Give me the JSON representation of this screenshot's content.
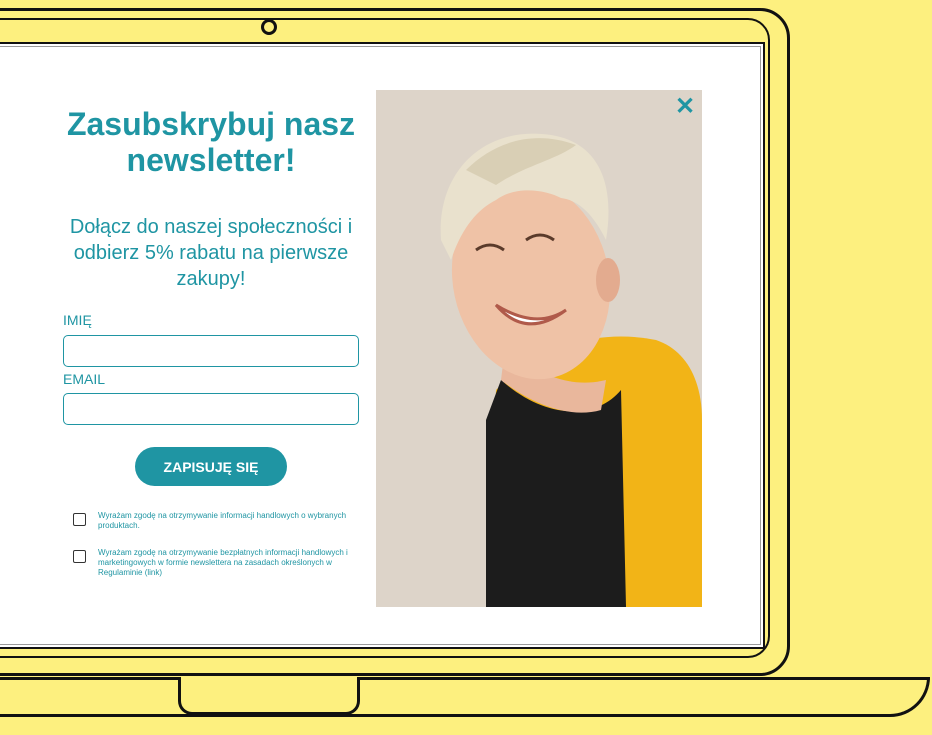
{
  "popup": {
    "title": "Zasubskrybuj nasz newsletter!",
    "subtitle": "Dołącz do naszej społeczności i odbierz 5% rabatu na pierwsze zakupy!",
    "name_label": "IMIĘ",
    "email_label": "EMAIL",
    "name_value": "",
    "email_value": "",
    "submit_label": "ZAPISUJĘ SIĘ",
    "consents": [
      "Wyrażam zgodę na otrzymywanie informacji handlowych o wybranych produktach.",
      "Wyrażam zgodę na otrzymywanie bezpłatnych informacji handlowych i marketingowych w formie newslettera na zasadach określonych w Regulaminie (link)"
    ],
    "close_icon": "close-icon",
    "photo_icon": "person-photo"
  },
  "colors": {
    "accent": "#1f95a3",
    "background": "#fdf07f",
    "shirt_yellow": "#f2b417",
    "shirt_black": "#1c1c1c"
  }
}
